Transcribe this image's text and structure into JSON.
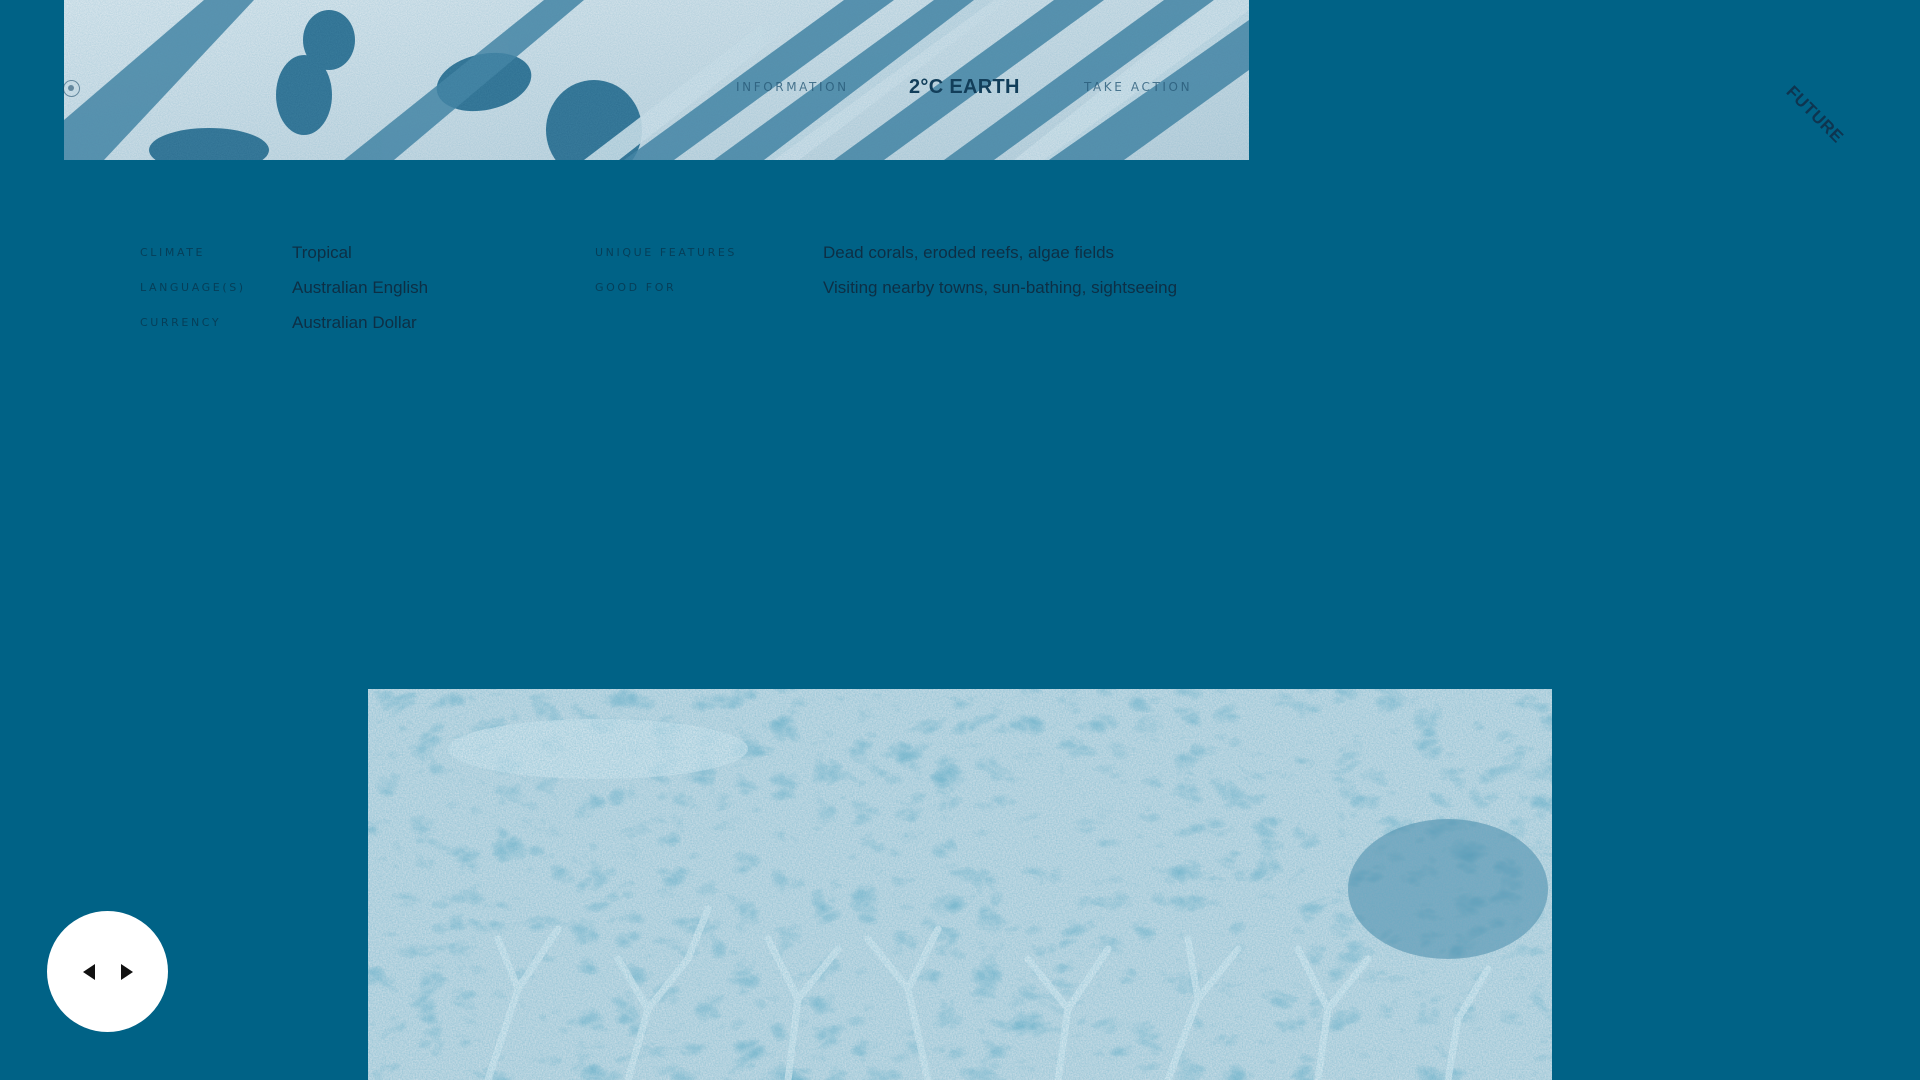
{
  "header": {
    "nav_left": "INFORMATION",
    "logo": "2°C EARTH",
    "nav_right": "TAKE ACTION",
    "corner_label": "FUTURE"
  },
  "info": {
    "climate": {
      "label": "CLIMATE",
      "value": "Tropical"
    },
    "languages": {
      "label": "LANGUAGE(S)",
      "value": "Australian English"
    },
    "currency": {
      "label": "CURRENCY",
      "value": "Australian Dollar"
    },
    "unique_features": {
      "label": "UNIQUE FEATURES",
      "value": "Dead corals, eroded reefs, algae fields"
    },
    "good_for": {
      "label": "GOOD FOR",
      "value": "Visiting nearby towns, sun-bathing, sightseeing"
    }
  },
  "colors": {
    "background": "#006286",
    "accent_dark": "#0d2f45",
    "control_bg": "#ffffff"
  },
  "icons": {
    "nav_dot": "circle-dot-icon",
    "prev": "arrow-left-icon",
    "next": "arrow-right-icon"
  }
}
